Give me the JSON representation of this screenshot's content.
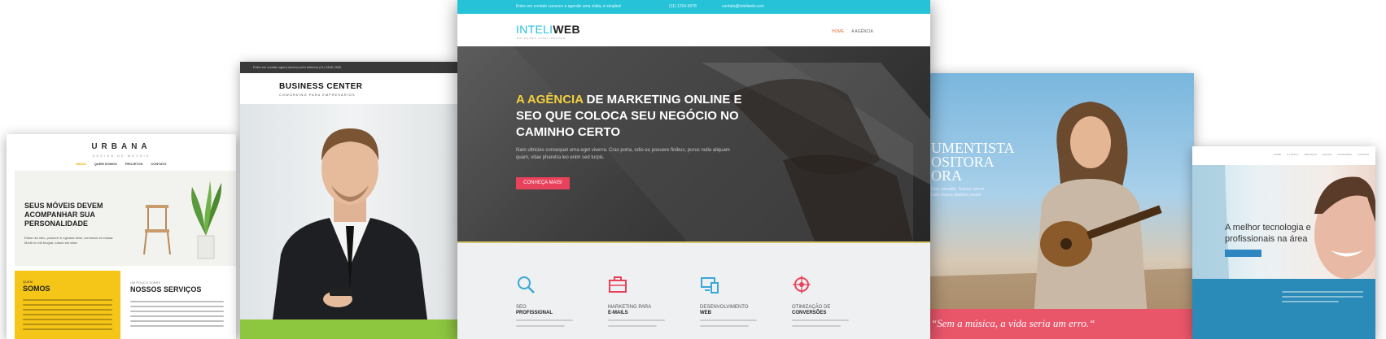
{
  "urbana": {
    "logo": "URBANA",
    "tagline": "DESIGN DE MÓVEIS",
    "nav": [
      "INÍCIO",
      "QUEM SOMOS",
      "PROJETOS",
      "CONTATO"
    ],
    "hero_title": "SEUS MÓVEIS DEVEM ACOMPANHAR SUA PERSONALIDADE",
    "hero_text": "Etiam dui odio, posuere in egestas vitae, commodo et massa. Morbi eu elit feugiat, rutrum est vitae.",
    "about_small": "QUEM",
    "about_title": "SOMOS",
    "services_small": "UM POUCO SOBRE",
    "services_title": "NOSSOS SERVIÇOS"
  },
  "business": {
    "topbar": "Entre em contato agora mesmo pelo telefone (11) 3456-7890",
    "title": "BUSINESS CENTER",
    "subtitle": "COWORKING PARA EMPRESÁRIOS"
  },
  "inteliweb": {
    "topbar_text": "Entre em contato conosco e agende uma visita, é simples!",
    "phone": "(11) 1234-5678",
    "email": "contato@inteliweb.com",
    "logo_a": "INTELI",
    "logo_b": "WEB",
    "slogan": "SOLUÇÕES INTELIGENTES",
    "nav": [
      "HOME",
      "A AGÊNCIA"
    ],
    "hero_highlight": "A AGÊNCIA",
    "hero_title_rest": " DE MARKETING ONLINE E SEO QUE COLOCA SEU NEGÓCIO NO CAMINHO CERTO",
    "hero_text": "Nam ultricies consequat urna eget viverra. Cras porta, odio eu posuere finibus, purus nulla aliquam quam, vitae pharetra leo enim sed turpis.",
    "cta": "CONHEÇA MAIS!",
    "services": [
      {
        "line1": "SEO",
        "line2": "PROFISSIONAL",
        "icon": "magnifier-icon",
        "color": "#3aa8d8"
      },
      {
        "line1": "MARKETING PARA",
        "line2": "E-MAILS",
        "icon": "briefcase-icon",
        "color": "#e8415b"
      },
      {
        "line1": "DESENVOLVIMENTO",
        "line2": "WEB",
        "icon": "devices-icon",
        "color": "#3aa8d8"
      },
      {
        "line1": "OTIMIZAÇÃO DE",
        "line2": "CONVERSÕES",
        "icon": "target-icon",
        "color": "#e8415b"
      }
    ]
  },
  "music": {
    "title": "UMENTISTA OSITORA ORA",
    "text": "Cras convallis. Nullam rutrum nulla massa dapibus ornare",
    "quote": "“Sem a música, a vida seria um erro.“"
  },
  "dental": {
    "nav": [
      "HOME",
      "A CLÍNICA",
      "SERVIÇOS",
      "EQUIPE",
      "NOVIDADES",
      "CONTATO"
    ],
    "hero_title": "A melhor tecnologia e profissionais na área"
  }
}
